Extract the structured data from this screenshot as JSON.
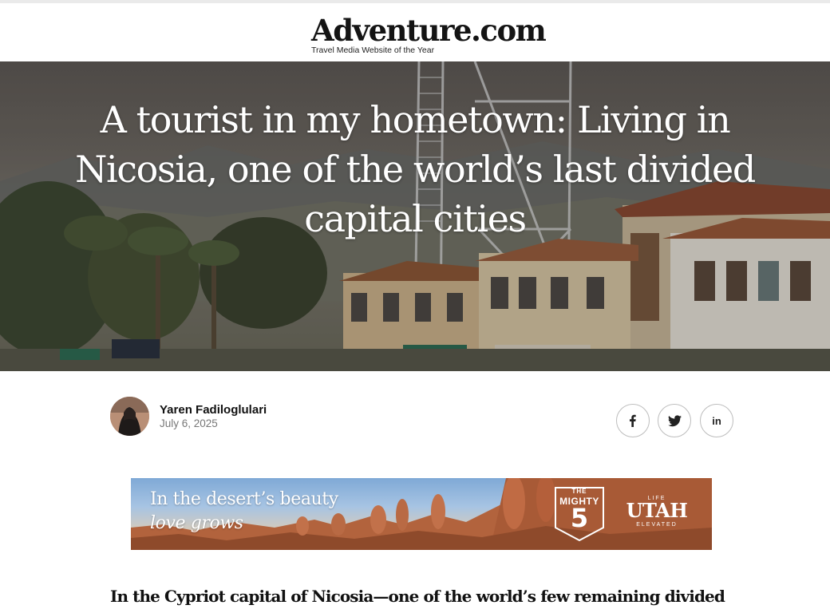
{
  "header": {
    "logo": "Adventure.com",
    "tagline": "Travel Media Website of the Year"
  },
  "hero": {
    "title": "A tourist in my hometown: Living in Nicosia, one of the world’s last divided capital cities"
  },
  "author": {
    "name": "Yaren Fadiloglulari",
    "date": "July 6, 2025"
  },
  "share": {
    "icons": [
      "facebook-icon",
      "twitter-icon",
      "linkedin-icon"
    ],
    "linkedin_label": "in"
  },
  "ad": {
    "line1": "In the desert’s beauty",
    "line2": "love grows",
    "badge": {
      "top": "THE",
      "middle": "MIGHTY",
      "number": "5"
    },
    "brand": {
      "top": "LIFE",
      "word": "UTAH",
      "bottom": "ELEVATED"
    }
  },
  "article": {
    "lead": "In the Cypriot capital of Nicosia—one of the world’s few remaining divided"
  },
  "colors": {
    "text": "#111111",
    "muted": "#777777",
    "border": "#bdbdbd"
  }
}
